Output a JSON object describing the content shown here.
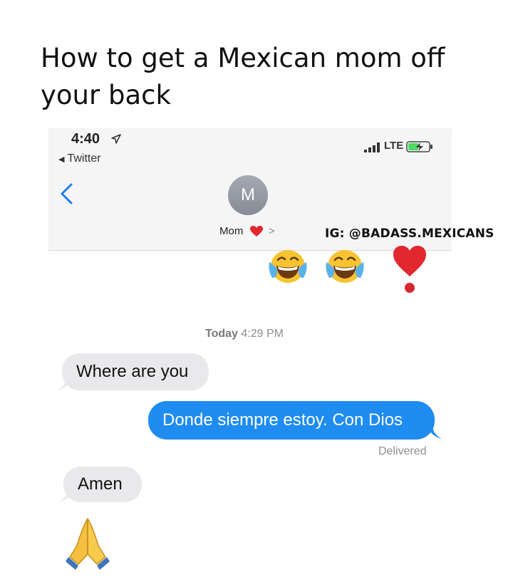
{
  "caption": "How to get a Mexican mom off your back",
  "status_bar": {
    "time": "4:40",
    "back_app": "Twitter",
    "network": "LTE"
  },
  "contact": {
    "initial": "M",
    "name": "Mom"
  },
  "watermark": "IG: @BADASS.MEXICANS",
  "thread": {
    "timestamp_day": "Today",
    "timestamp_time": "4:29 PM",
    "messages": [
      {
        "direction": "incoming",
        "text": "Where are you"
      },
      {
        "direction": "outgoing",
        "text": "Donde siempre estoy. Con Dios"
      },
      {
        "direction": "incoming",
        "text": "Amen"
      }
    ],
    "delivered_label": "Delivered"
  },
  "colors": {
    "outgoing_bubble": "#1e8cf0",
    "incoming_bubble": "#e9e9eb",
    "heart": "#e0282e",
    "ios_blue": "#1a7df0"
  },
  "icons": [
    "location-arrow-icon",
    "signal-bars-icon",
    "battery-charging-icon",
    "back-chevron-icon",
    "heart-icon",
    "face-with-tears-of-joy-emoji",
    "heavy-heart-exclamation-emoji",
    "folded-hands-emoji"
  ]
}
